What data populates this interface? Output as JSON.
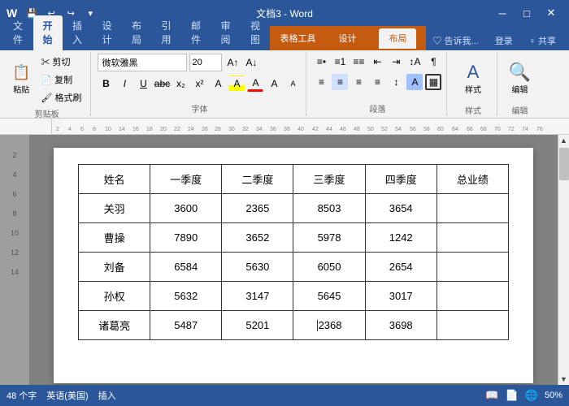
{
  "titleBar": {
    "title": "文档3 - Word",
    "minBtn": "─",
    "maxBtn": "□",
    "closeBtn": "✕"
  },
  "ribbonTabs": {
    "main": [
      "文件",
      "开始",
      "插入",
      "设计",
      "布局",
      "引用",
      "邮件",
      "审阅",
      "视图"
    ],
    "active": "开始",
    "tools": {
      "label": "表格工具",
      "tabs": [
        "设计",
        "布局"
      ],
      "active": "布局"
    },
    "right": [
      "♡ 告诉我...",
      "登录",
      "♀ 共享"
    ]
  },
  "ribbon": {
    "groups": [
      {
        "name": "剪贴板",
        "label": "剪贴板"
      },
      {
        "name": "字体",
        "label": "字体",
        "fontName": "微软雅黑",
        "fontSize": "20"
      },
      {
        "name": "段落",
        "label": "段落"
      },
      {
        "name": "样式",
        "label": "样式"
      },
      {
        "name": "编辑",
        "label": "编辑"
      }
    ]
  },
  "table": {
    "headers": [
      "姓名",
      "一季度",
      "二季度",
      "三季度",
      "四季度",
      "总业绩"
    ],
    "rows": [
      [
        "关羽",
        "3600",
        "2365",
        "8503",
        "3654",
        ""
      ],
      [
        "曹操",
        "7890",
        "3652",
        "5978",
        "1242",
        ""
      ],
      [
        "刘备",
        "6584",
        "5630",
        "6050",
        "2654",
        ""
      ],
      [
        "孙权",
        "5632",
        "3147",
        "5645",
        "3017",
        ""
      ],
      [
        "诸葛亮",
        "5487",
        "5201",
        "2368",
        "3698",
        ""
      ]
    ]
  },
  "statusBar": {
    "wordCount": "48 个字",
    "language": "英语(美国)",
    "insertMode": "插入",
    "zoom": "50%"
  }
}
